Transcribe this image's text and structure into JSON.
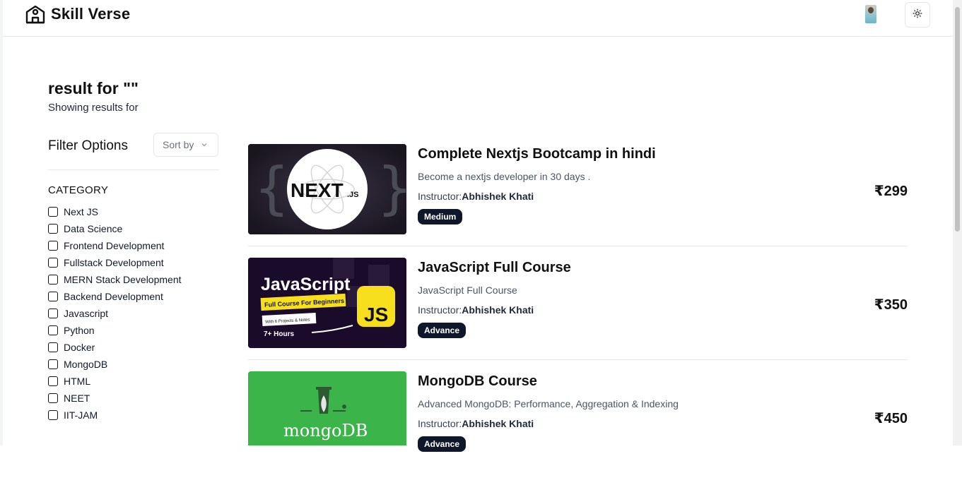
{
  "app": {
    "name": "Skill Verse"
  },
  "header": {
    "result_title": "result for \"\"",
    "result_subtitle": "Showing results for"
  },
  "filters": {
    "heading": "Filter Options",
    "sort_label": "Sort by",
    "category_title": "CATEGORY",
    "categories": [
      "Next JS",
      "Data Science",
      "Frontend Development",
      "Fullstack Development",
      "MERN Stack Development",
      "Backend Development",
      "Javascript",
      "Python",
      "Docker",
      "MongoDB",
      "HTML",
      "NEET",
      "IIT-JAM"
    ]
  },
  "courses": [
    {
      "title": "Complete Nextjs Bootcamp in hindi",
      "subtitle": "Become a nextjs developer in 30 days .",
      "instructor_label": "Instructor:",
      "instructor": "Abhishek Khati",
      "level": "Medium",
      "price": "₹299",
      "thumb_text": [
        "NEXT",
        ".JS"
      ]
    },
    {
      "title": "JavaScript Full Course",
      "subtitle": "JavaScript Full Course",
      "instructor_label": "Instructor:",
      "instructor": "Abhishek Khati",
      "level": "Advance",
      "price": "₹350",
      "thumb_text": [
        "JavaScript",
        "Full Course For Beginners",
        "With 6 Projects & Notes",
        "7+ Hours",
        "JS"
      ]
    },
    {
      "title": "MongoDB Course",
      "subtitle": "Advanced MongoDB: Performance, Aggregation & Indexing",
      "instructor_label": "Instructor:",
      "instructor": "Abhishek Khati",
      "level": "Advance",
      "price": "₹450",
      "thumb_text": [
        "mongoDB"
      ]
    }
  ],
  "colors": {
    "badge": "#0f172a",
    "divider": "#e5e7eb",
    "mongo_green": "#3bb54a",
    "js_yellow": "#f7df1e"
  }
}
